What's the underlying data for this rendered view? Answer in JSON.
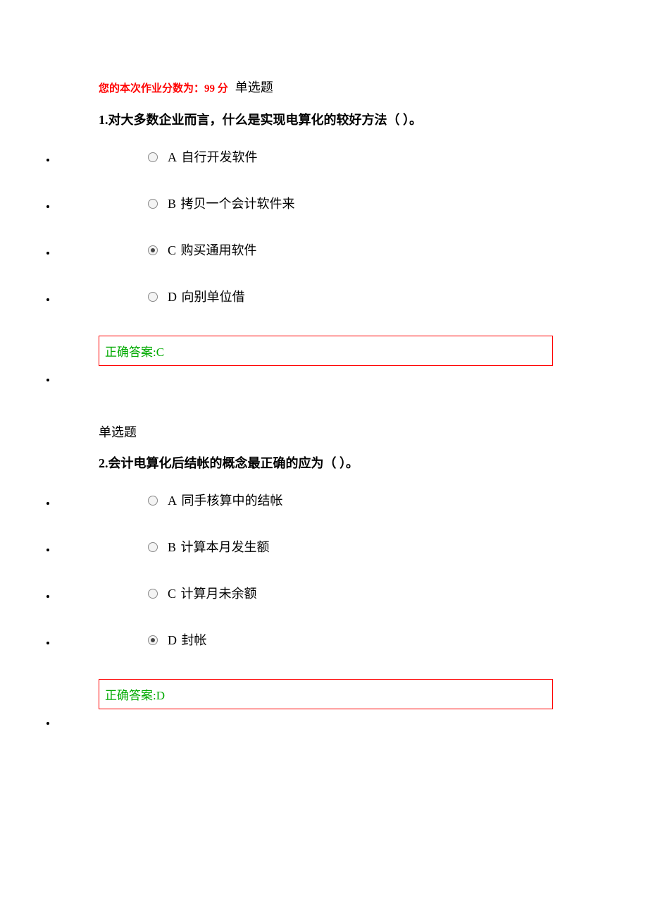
{
  "header": {
    "score_text": "您的本次作业分数为：99 分",
    "qtype_label": "单选题"
  },
  "questions": [
    {
      "qtype": "单选题",
      "number": "1.",
      "text": "对大多数企业而言，什么是实现电算化的较好方法（ ）。",
      "options": [
        {
          "letter": "A",
          "label": "自行开发软件",
          "selected": false
        },
        {
          "letter": "B",
          "label": "拷贝一个会计软件来",
          "selected": false
        },
        {
          "letter": "C",
          "label": "购买通用软件",
          "selected": true
        },
        {
          "letter": "D",
          "label": "向别单位借",
          "selected": false
        }
      ],
      "answer": "正确答案:C"
    },
    {
      "qtype": "单选题",
      "number": "2.",
      "text": "会计电算化后结帐的概念最正确的应为（ ）。",
      "options": [
        {
          "letter": "A",
          "label": "同手核算中的结帐",
          "selected": false
        },
        {
          "letter": "B",
          "label": "计算本月发生额",
          "selected": false
        },
        {
          "letter": "C",
          "label": "计算月未余额",
          "selected": false
        },
        {
          "letter": "D",
          "label": "封帐",
          "selected": true
        }
      ],
      "answer": "正确答案:D"
    }
  ]
}
